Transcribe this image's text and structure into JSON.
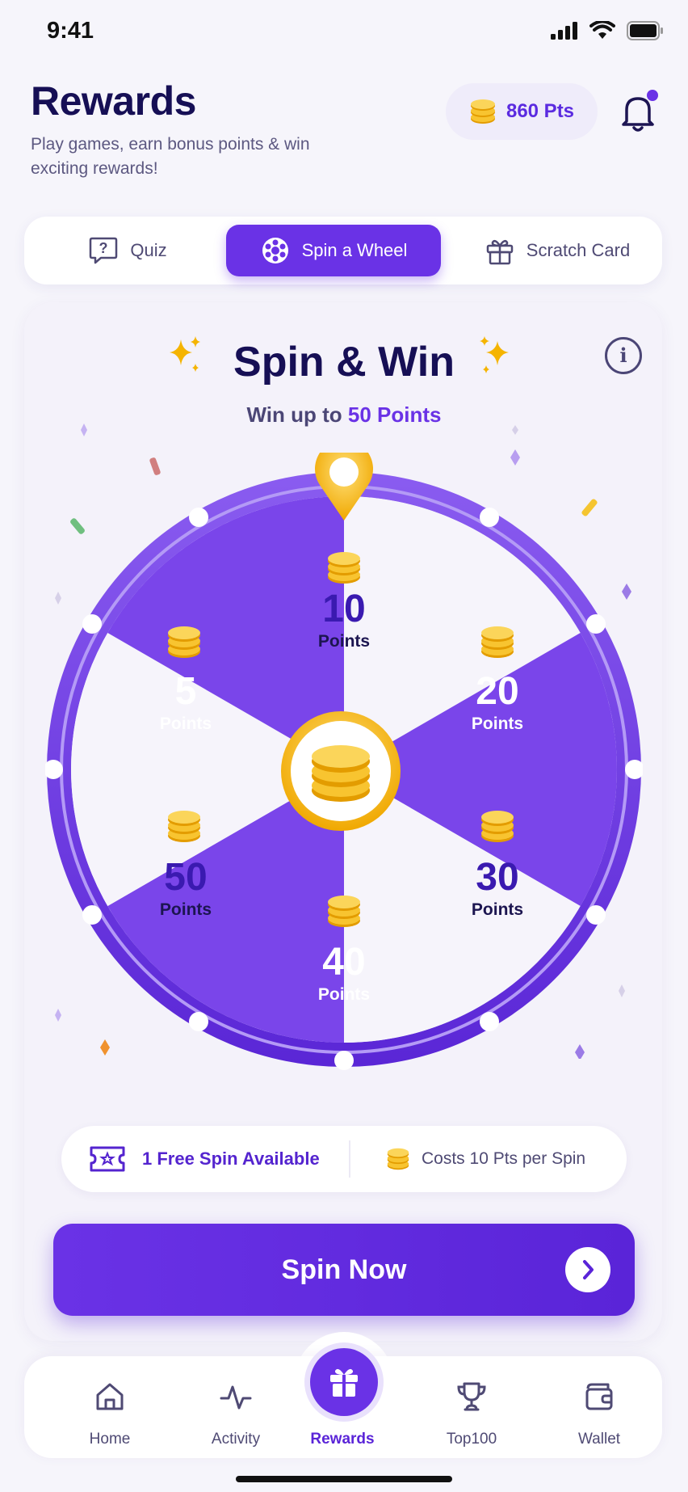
{
  "status": {
    "time": "9:41"
  },
  "header": {
    "title": "Rewards",
    "subtitle": "Play games, earn bonus points & win exciting rewards!",
    "points": "860 Pts",
    "bell_icon": "bell-icon",
    "has_notification": true
  },
  "tabs": [
    {
      "label": "Quiz",
      "icon": "quiz-icon",
      "active": false
    },
    {
      "label": "Spin a Wheel",
      "icon": "wheel-icon",
      "active": true
    },
    {
      "label": "Scratch Card",
      "icon": "gift-icon",
      "active": false
    }
  ],
  "spin": {
    "title": "Spin & Win",
    "subtitle_prefix": "Win up to",
    "subtitle_value": "50 Points",
    "segments": [
      {
        "value": "10",
        "unit": "Points"
      },
      {
        "value": "20",
        "unit": "Points"
      },
      {
        "value": "30",
        "unit": "Points"
      },
      {
        "value": "40",
        "unit": "Points"
      },
      {
        "value": "50",
        "unit": "Points"
      },
      {
        "value": "5",
        "unit": "Points"
      }
    ],
    "free_spin": "1 Free Spin Available",
    "cost": "Costs 10 Pts per Spin",
    "button_label": "Spin Now"
  },
  "nav": [
    {
      "label": "Home",
      "icon": "home-icon",
      "active": false
    },
    {
      "label": "Activity",
      "icon": "activity-icon",
      "active": false
    },
    {
      "label": "Rewards",
      "icon": "gift-icon",
      "active": true
    },
    {
      "label": "Top100",
      "icon": "trophy-icon",
      "active": false
    },
    {
      "label": "Wallet",
      "icon": "wallet-icon",
      "active": false
    }
  ],
  "colors": {
    "primary": "#6a32e6",
    "dark_text": "#160f55",
    "gold": "#f5b400"
  }
}
